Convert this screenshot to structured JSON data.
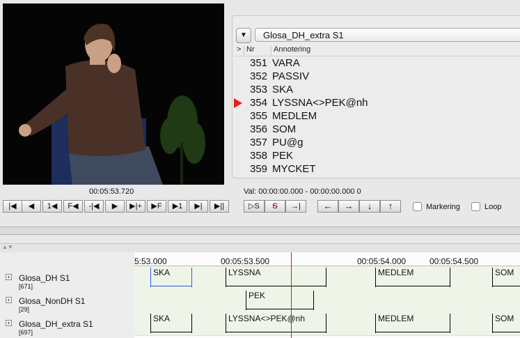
{
  "video": {
    "current_time": "00:05:53.720"
  },
  "annotation_list": {
    "tier_dropdown_value": "Glosa_DH_extra S1",
    "columns": {
      "marker": ">",
      "nr": "Nr",
      "annotation": "Annotering"
    },
    "rows": [
      {
        "nr": "351",
        "text": "VARA",
        "current": false
      },
      {
        "nr": "352",
        "text": "PASSIV",
        "current": false
      },
      {
        "nr": "353",
        "text": "SKA",
        "current": false
      },
      {
        "nr": "354",
        "text": "LYSSNA<>PEK@nh",
        "current": true
      },
      {
        "nr": "355",
        "text": "MEDLEM",
        "current": false
      },
      {
        "nr": "356",
        "text": "SOM",
        "current": false
      },
      {
        "nr": "357",
        "text": "PU@g",
        "current": false
      },
      {
        "nr": "358",
        "text": "PEK",
        "current": false
      },
      {
        "nr": "359",
        "text": "MYCKET",
        "current": false
      }
    ]
  },
  "selection": {
    "label": "Val:",
    "range": "00:00:00.000 - 00:00:00.000",
    "length": "0"
  },
  "media_controls": {
    "buttons": [
      "|◀",
      "◀",
      "1◀",
      "F◀",
      "-|◀",
      "▶",
      "▶|+",
      "▶F",
      "▶1",
      "▶|",
      "▶||"
    ],
    "selection_buttons": [
      "▷S",
      "S",
      "→|"
    ],
    "nav_buttons": [
      "←",
      "→",
      "↓",
      "↑"
    ],
    "marker_label": "Markering",
    "loop_label": "Loop"
  },
  "timeline": {
    "ticks": [
      "5:53.000",
      "00:05:53.500",
      "00:05:54.000",
      "00:05:54.500"
    ],
    "tiers": [
      {
        "name": "Glosa_DH S1",
        "count": "[671]",
        "annotations": [
          {
            "text": "SKA",
            "selected": true
          },
          {
            "text": "LYSSNA",
            "selected": false
          },
          {
            "text": "MEDLEM",
            "selected": false
          },
          {
            "text": "SOM",
            "selected": false
          }
        ]
      },
      {
        "name": "Glosa_NonDH S1",
        "count": "[29]",
        "annotations": [
          {
            "text": "PEK",
            "selected": false
          }
        ]
      },
      {
        "name": "Glosa_DH_extra S1",
        "count": "[697]",
        "annotations": [
          {
            "text": "SKA",
            "selected": false
          },
          {
            "text": "LYSSNA<>PEK@nh",
            "selected": false
          },
          {
            "text": "MEDLEM",
            "selected": false
          },
          {
            "text": "SOM",
            "selected": false
          }
        ]
      }
    ]
  },
  "colors": {
    "crosshair": "#d31d1d",
    "current_pointer": "#ee1c1c",
    "tier_bg": "#eef5e8"
  }
}
